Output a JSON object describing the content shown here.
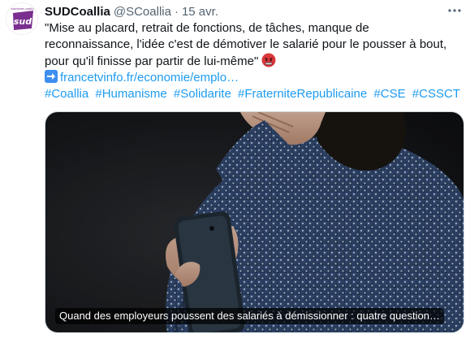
{
  "tweet": {
    "author_name": "SUDCoallia",
    "handle": "@SCoallia",
    "separator": "·",
    "date": "15 avr.",
    "text_lines": [
      "\"Mise au placard, retrait de fonctions, de tâches, manque de",
      "reconnaissance, l'idée c'est de démotiver le salarié pour le pousser à bout,",
      "pour qu'il finisse par partir de lui-même\""
    ],
    "link_text": "francetvinfo.fr/economie/emplo…",
    "hashtags": [
      "#Coallia",
      "#Humanisme",
      "#Solidarite",
      "#FraterniteRepublicaine",
      "#CSE",
      "#CSSCT"
    ],
    "card_caption": "Quand des employeurs poussent des salariés à démissionner : quatre question…"
  },
  "avatar": {
    "logo_text": "sud",
    "logo_small_text": "solidaires coallia",
    "color": "#7a2e8f"
  },
  "icons": {
    "more": "more-horizontal-icon",
    "emoji_angry": "angry-face-emoji-icon",
    "emoji_arrow": "right-arrow-emoji-icon"
  },
  "colors": {
    "link": "#1d9bf0",
    "secondary_text": "#536471"
  }
}
